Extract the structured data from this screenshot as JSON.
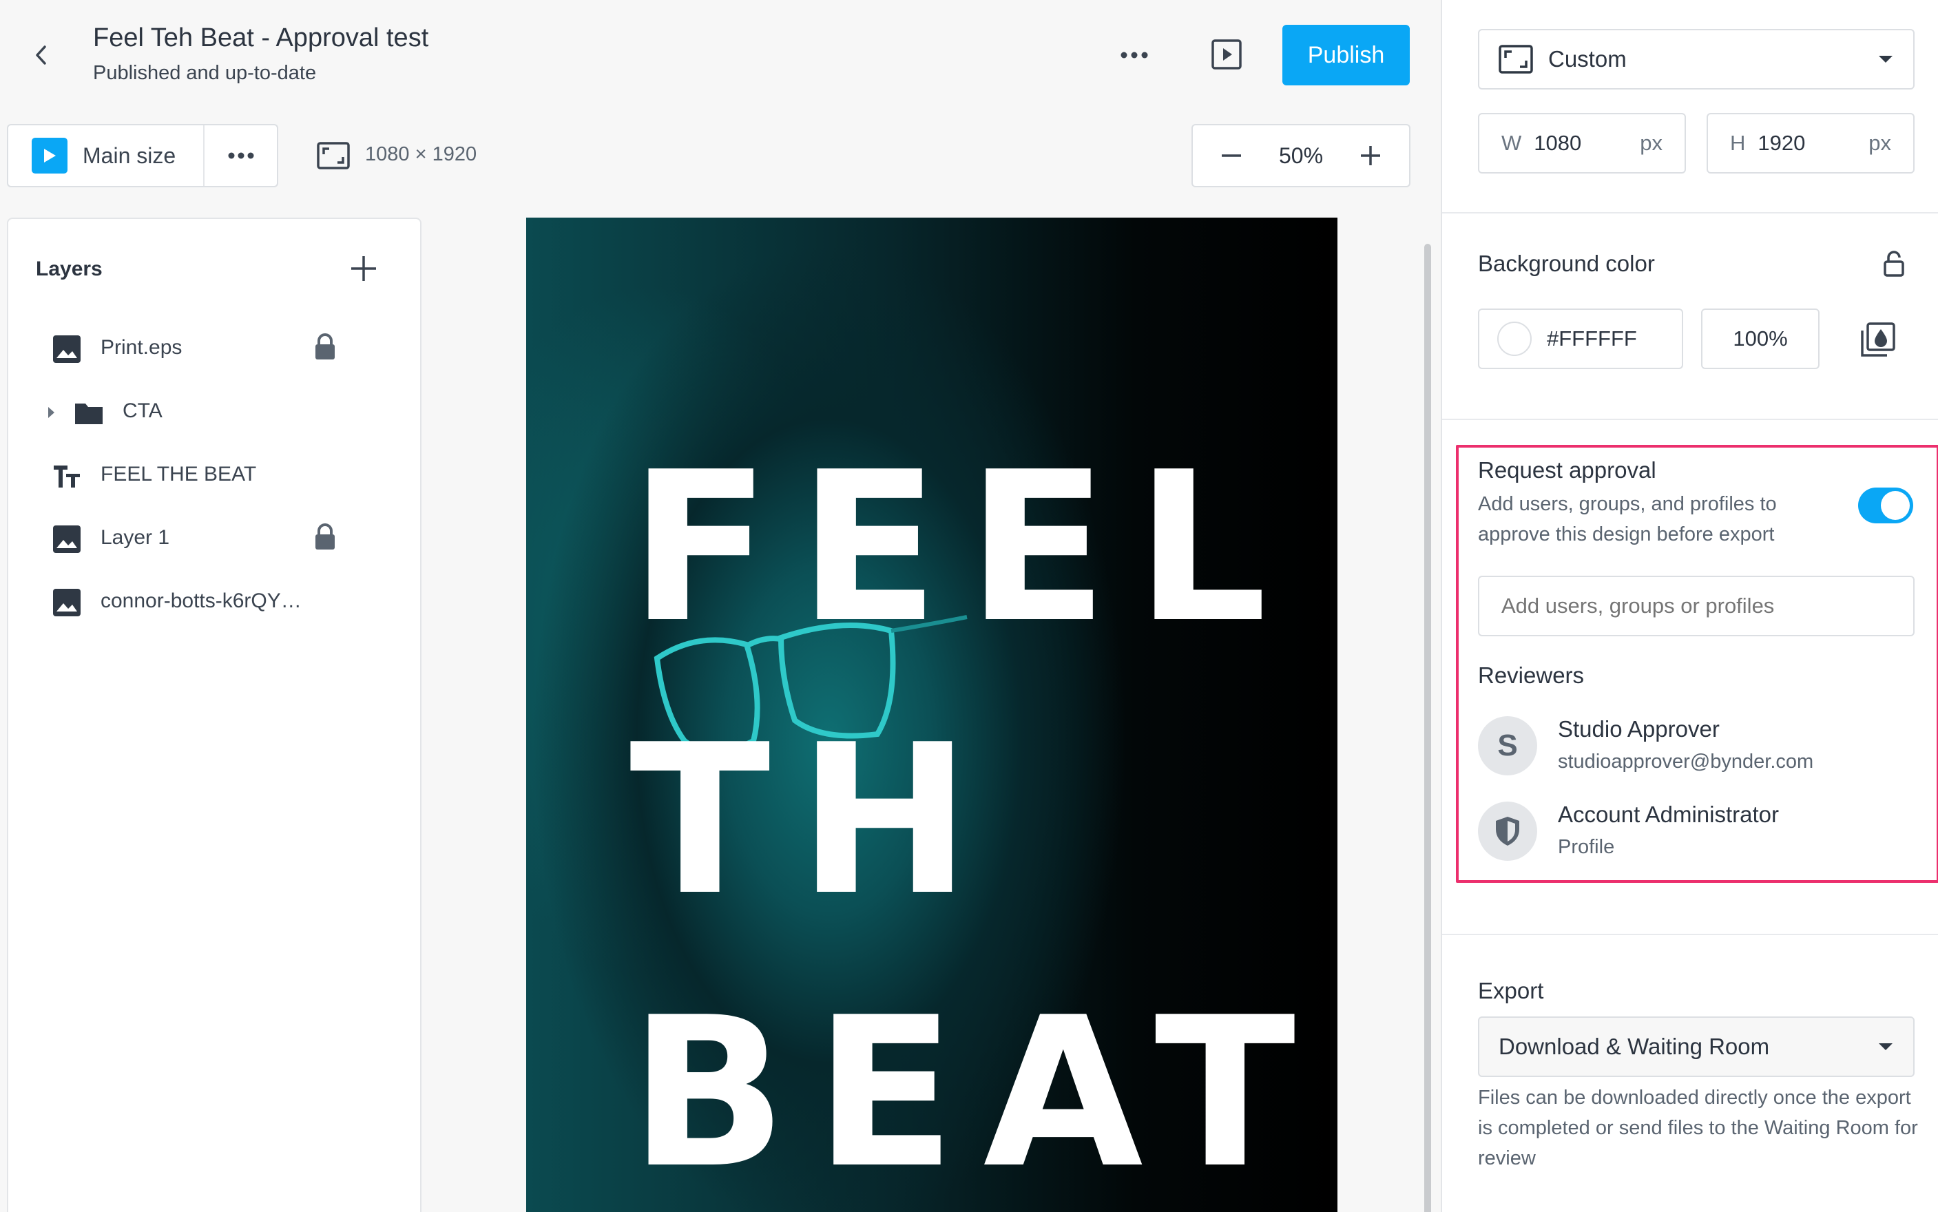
{
  "header": {
    "back_icon": "chevron-left-icon",
    "title": "Feel Teh Beat - Approval test",
    "status": "Published and up-to-date",
    "more_icon": "more-horizontal-icon",
    "preview_icon": "play-preview-icon",
    "publish_label": "Publish"
  },
  "size_toolbar": {
    "main_size_label": "Main size",
    "dimensions": "1080 × 1920",
    "zoom": "50%"
  },
  "layers": {
    "title": "Layers",
    "items": [
      {
        "name": "Print.eps",
        "icon": "image-icon",
        "locked": true
      },
      {
        "name": "CTA",
        "icon": "folder-icon",
        "locked": false,
        "expandable": true
      },
      {
        "name": "FEEL THE BEAT",
        "icon": "text-icon",
        "locked": false
      },
      {
        "name": "Layer 1",
        "icon": "image-icon",
        "locked": true
      },
      {
        "name": "connor-botts-k6rQY…",
        "icon": "image-icon",
        "locked": false
      }
    ]
  },
  "canvas": {
    "line1": "FEEL",
    "line2": "TH",
    "line3": "BEAT"
  },
  "properties": {
    "size_preset": "Custom",
    "width_prefix": "W",
    "width_value": "1080",
    "height_prefix": "H",
    "height_value": "1920",
    "unit": "px",
    "background_title": "Background color",
    "background_hex": "#FFFFFF",
    "background_opacity": "100%"
  },
  "approval": {
    "title": "Request approval",
    "description": "Add users, groups, and profiles to approve this design before export",
    "enabled": true,
    "input_placeholder": "Add users, groups or profiles",
    "reviewers_title": "Reviewers",
    "reviewers": [
      {
        "initial": "S",
        "name": "Studio Approver",
        "detail": "studioapprover@bynder.com"
      },
      {
        "icon": "shield-icon",
        "name": "Account Administrator",
        "detail": "Profile"
      }
    ]
  },
  "export": {
    "title": "Export",
    "selected": "Download & Waiting Room",
    "description": "Files can be downloaded directly once the export is completed or send files to the Waiting Room for review"
  },
  "colors": {
    "accent": "#0aa7f5",
    "highlight": "#ec2f6d",
    "text": "#2c3440"
  }
}
